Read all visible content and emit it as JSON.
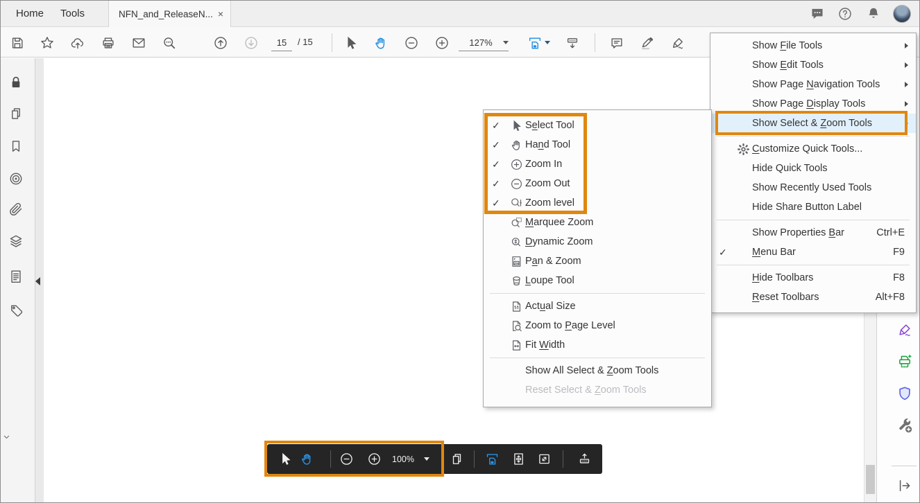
{
  "colors": {
    "accent_orange": "#E0870F",
    "tool_blue": "#1B8CE3",
    "hud_background": "#252525"
  },
  "tab_bar": {
    "tabs": [
      {
        "label": "Home"
      },
      {
        "label": "Tools"
      }
    ],
    "document_tab": {
      "label": "NFN_and_ReleaseN...",
      "close_label": "×"
    },
    "right_icons": [
      "chat",
      "help",
      "notifications",
      "avatar"
    ]
  },
  "toolbar": {
    "page_current": "15",
    "page_total_label": "/ 15",
    "zoom_value": "127%",
    "icons": [
      "save",
      "star",
      "cloud-upload",
      "print",
      "email",
      "search",
      "page-up",
      "page-down",
      "select-tool",
      "hand-tool",
      "zoom-out",
      "zoom-in",
      "fit-width",
      "scroll-mode",
      "comment",
      "highlight",
      "fill-sign"
    ]
  },
  "sidebar_left": {
    "icons": [
      "lock",
      "page-thumbnails",
      "bookmarks",
      "destinations",
      "attachments",
      "layers",
      "content",
      "tags"
    ]
  },
  "sidebar_right": {
    "icons": [
      "fill-sign-pen",
      "scan-ocr",
      "protect-shield",
      "more-tools-wrench",
      "expand-pane"
    ]
  },
  "hud": {
    "zoom_value": "100%",
    "icons": [
      "select-tool",
      "hand-tool",
      "zoom-out",
      "zoom-in",
      "page-view",
      "fit-width",
      "fit-one-page",
      "full-screen",
      "show-toolbar"
    ]
  },
  "context_menu": {
    "items": [
      {
        "label": "Show File Tools",
        "u": 5,
        "arrow": true
      },
      {
        "label": "Show Edit Tools",
        "u": 5,
        "arrow": true
      },
      {
        "label": "Show Page Navigation Tools",
        "u": 10,
        "arrow": true
      },
      {
        "label": "Show Page Display Tools",
        "u": 10,
        "arrow": true
      },
      {
        "label": "Show Select & Zoom Tools",
        "u": 14,
        "arrow": true,
        "highlighted": true
      },
      {
        "sep": true
      },
      {
        "label": "Customize Quick Tools...",
        "u": 0,
        "icon": "gear"
      },
      {
        "label": "Hide Quick Tools"
      },
      {
        "label": "Show Recently Used Tools"
      },
      {
        "label": "Hide Share Button Label"
      },
      {
        "sep": true
      },
      {
        "label": "Show Properties Bar",
        "u": 16,
        "shortcut": "Ctrl+E"
      },
      {
        "label": "Menu Bar",
        "u": 0,
        "shortcut": "F9",
        "checked": true
      },
      {
        "sep": true
      },
      {
        "label": "Hide Toolbars",
        "u": 0,
        "shortcut": "F8"
      },
      {
        "label": "Reset Toolbars",
        "u": 0,
        "shortcut": "Alt+F8"
      }
    ]
  },
  "submenu": {
    "items": [
      {
        "label": "Select Tool",
        "u": 1,
        "icon": "cursor",
        "checked": true
      },
      {
        "label": "Hand Tool",
        "u": 2,
        "icon": "hand",
        "checked": true
      },
      {
        "label": "Zoom In",
        "icon": "circle-plus",
        "checked": true
      },
      {
        "label": "Zoom Out",
        "icon": "circle-minus",
        "checked": true
      },
      {
        "label": "Zoom level",
        "icon": "zoom-level",
        "checked": true
      },
      {
        "label": "Marquee Zoom",
        "u": 0,
        "icon": "marquee-zoom"
      },
      {
        "label": "Dynamic Zoom",
        "u": 0,
        "icon": "dynamic-zoom"
      },
      {
        "label": "Pan & Zoom",
        "u": 1,
        "icon": "pan-zoom"
      },
      {
        "label": "Loupe Tool",
        "u": 0,
        "icon": "loupe"
      },
      {
        "sep": true
      },
      {
        "label": "Actual Size",
        "u": 3,
        "icon": "actual-size"
      },
      {
        "label": "Zoom to Page Level",
        "u": 8,
        "icon": "zoom-page-level"
      },
      {
        "label": "Fit Width",
        "u": 4,
        "icon": "fit-width-page"
      },
      {
        "sep": true
      },
      {
        "label": "Show All Select & Zoom Tools",
        "u": 18
      },
      {
        "label": "Reset Select & Zoom Tools",
        "u": 15,
        "disabled": true
      }
    ]
  }
}
